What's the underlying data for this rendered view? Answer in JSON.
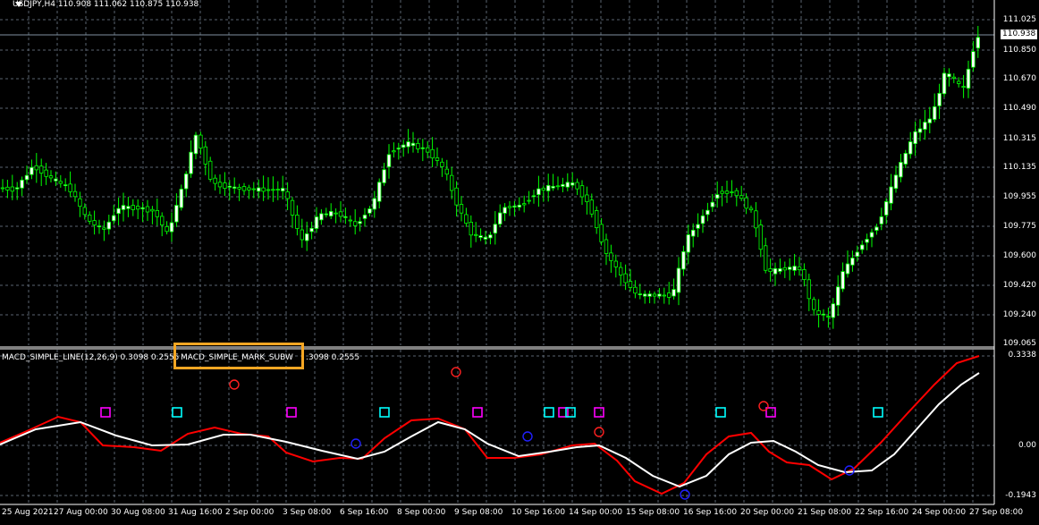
{
  "chart_title": "USDJPY,H4  110.908 111.062 110.875 110.938",
  "current_price": "110.938",
  "price_axis": [
    "111.025",
    "110.850",
    "110.670",
    "110.490",
    "110.315",
    "110.135",
    "109.955",
    "109.775",
    "109.600",
    "109.420",
    "109.240",
    "109.065"
  ],
  "sub_axis": [
    "0.3338",
    "0.00",
    "-0.1943"
  ],
  "sub_window": {
    "label_1": "MACD_SIMPLE_LINE(12,26,9) 0.3098 0.2555",
    "label_2": "MACD_SIMPLE_MARK_SUBW",
    "label_3": ".3098 0.2555"
  },
  "time_axis": [
    "25 Aug 2021",
    "27 Aug 00:00",
    "30 Aug 08:00",
    "31 Aug 16:00",
    "2 Sep 00:00",
    "3 Sep 08:00",
    "6 Sep 16:00",
    "8 Sep 00:00",
    "9 Sep 08:00",
    "10 Sep 16:00",
    "14 Sep 00:00",
    "15 Sep 08:00",
    "16 Sep 16:00",
    "20 Sep 00:00",
    "21 Sep 08:00",
    "22 Sep 16:00",
    "24 Sep 00:00",
    "27 Sep 08:00"
  ],
  "colors": {
    "background": "#000000",
    "grid": "#5a6470",
    "bull_candle": "#ffffff",
    "wick": "#00ff00",
    "macd_line": "#ff0000",
    "signal_line": "#ffffff",
    "mark_magenta": "#ff00ff",
    "mark_cyan": "#00ffff",
    "mark_red_circle": "#ff2020",
    "mark_blue_circle": "#2020ff",
    "highlight_box": "#f5a623"
  }
}
